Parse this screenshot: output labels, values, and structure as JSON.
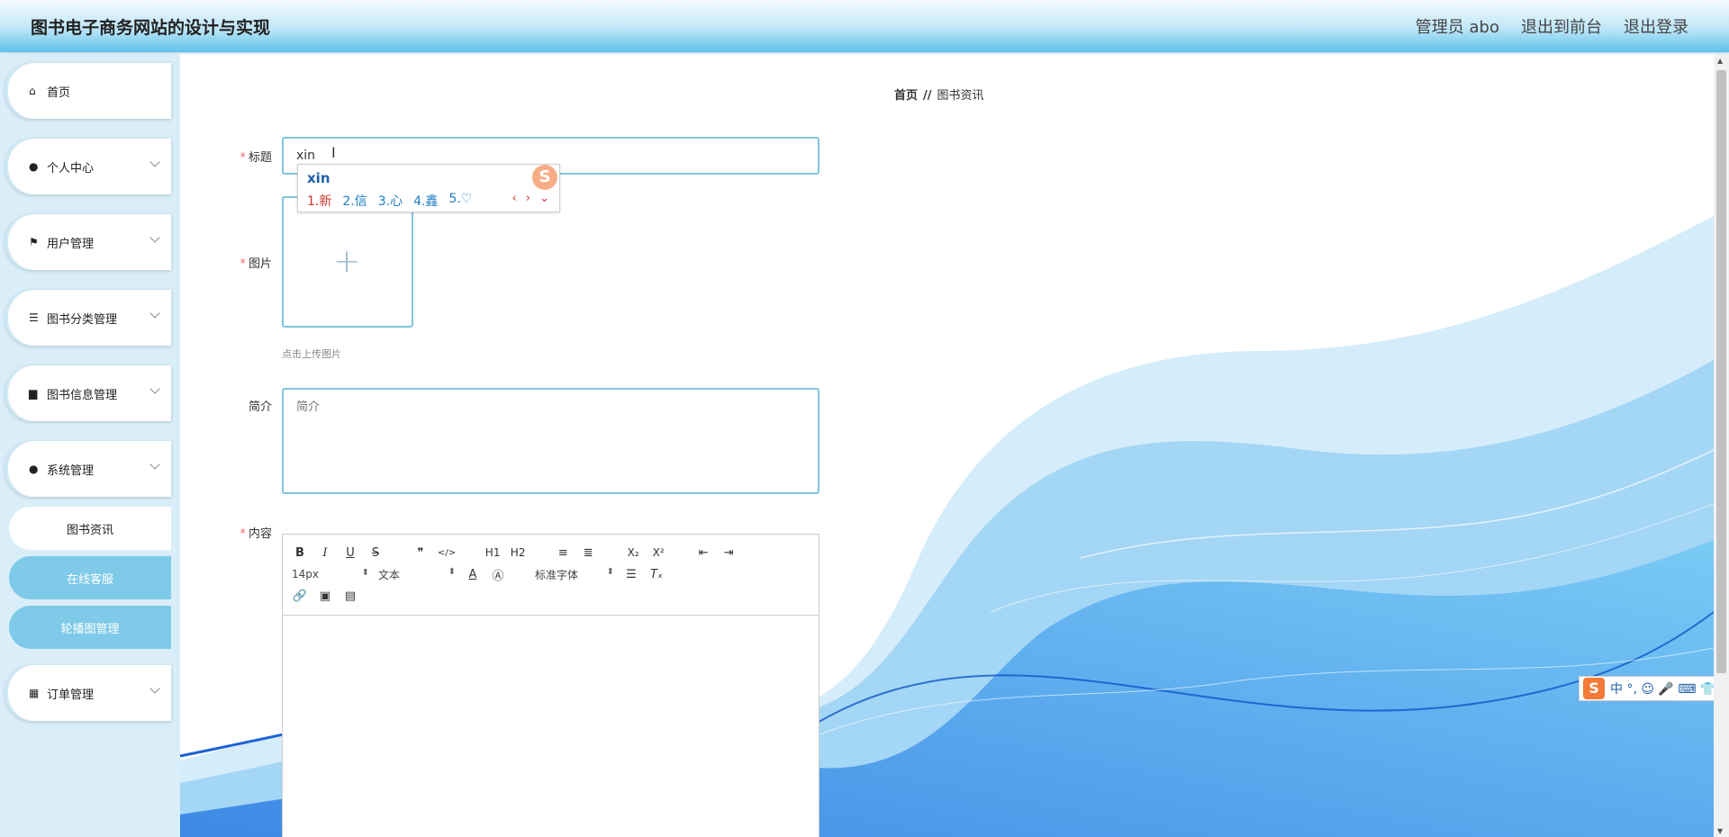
{
  "header": {
    "title": "图书电子商务网站的设计与实现",
    "admin": "管理员 abo",
    "back_to_front": "退出到前台",
    "logout": "退出登录"
  },
  "sidebar": {
    "items": [
      {
        "label": "首页",
        "icon": "home-icon"
      },
      {
        "label": "个人中心",
        "icon": "user-icon"
      },
      {
        "label": "用户管理",
        "icon": "flag-icon"
      },
      {
        "label": "图书分类管理",
        "icon": "sliders-icon"
      },
      {
        "label": "图书信息管理",
        "icon": "chat-icon"
      },
      {
        "label": "系统管理",
        "icon": "user-icon"
      },
      {
        "label": "订单管理",
        "icon": "grid-icon"
      }
    ],
    "sub_items": [
      {
        "label": "图书资讯"
      },
      {
        "label": "在线客服"
      },
      {
        "label": "轮播图管理"
      }
    ]
  },
  "breadcrumb": {
    "home": "首页",
    "sep": "//",
    "current": "图书资讯"
  },
  "form": {
    "title_label": "标题",
    "title_value": "xin",
    "image_label": "图片",
    "upload_tip": "点击上传图片",
    "intro_label": "简介",
    "intro_placeholder": "简介",
    "content_label": "内容"
  },
  "ime": {
    "pinyin": "xin",
    "candidates": [
      "1.新",
      "2.信",
      "3.心",
      "4.鑫",
      "5.♡"
    ],
    "bar_text": "中 °, ☺ 🎤 ⌨ 👕 ▦"
  },
  "editor": {
    "row1": [
      "B",
      "I",
      "U",
      "S",
      "❞",
      "</>",
      "H1",
      "H2",
      "≡",
      "≣",
      "X₂",
      "X²",
      "⇤",
      "⇥"
    ],
    "size": "14px",
    "format": "文本",
    "font": "标准字体"
  }
}
